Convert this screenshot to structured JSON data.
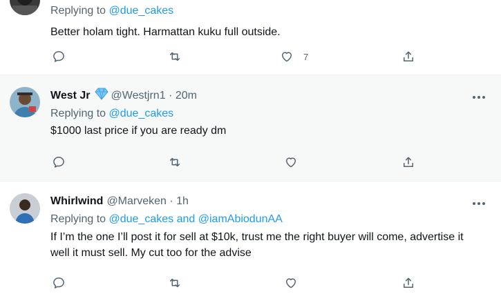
{
  "tweets": [
    {
      "reply_prefix": "Replying to",
      "reply_to": [
        "@due_cakes"
      ],
      "text": "Better holam tight. Harmattan kuku full outside.",
      "like_count": "7"
    },
    {
      "name": "West Jr",
      "badge_icon": "diamond-icon",
      "handle_time": "@Westjrn1 · 20m",
      "reply_prefix": "Replying to",
      "reply_to": [
        "@due_cakes"
      ],
      "text": "$1000 last price if you are ready dm"
    },
    {
      "name": "Whirlwind",
      "handle_time": "@Marveken · 1h",
      "reply_prefix": "Replying to",
      "reply_to": [
        "@due_cakes",
        "@iamAbiodunAA"
      ],
      "reply_joiner": "and",
      "text": "If I’m the one I’ll post it for sell at $10k, trust me the right buyer will come, advertise it well it must sell. My cut too for the advise"
    }
  ],
  "colors": {
    "link": "#1d9bf0",
    "muted": "#536471",
    "text": "#0f1419",
    "hover_bg": "#f7f9f9"
  }
}
